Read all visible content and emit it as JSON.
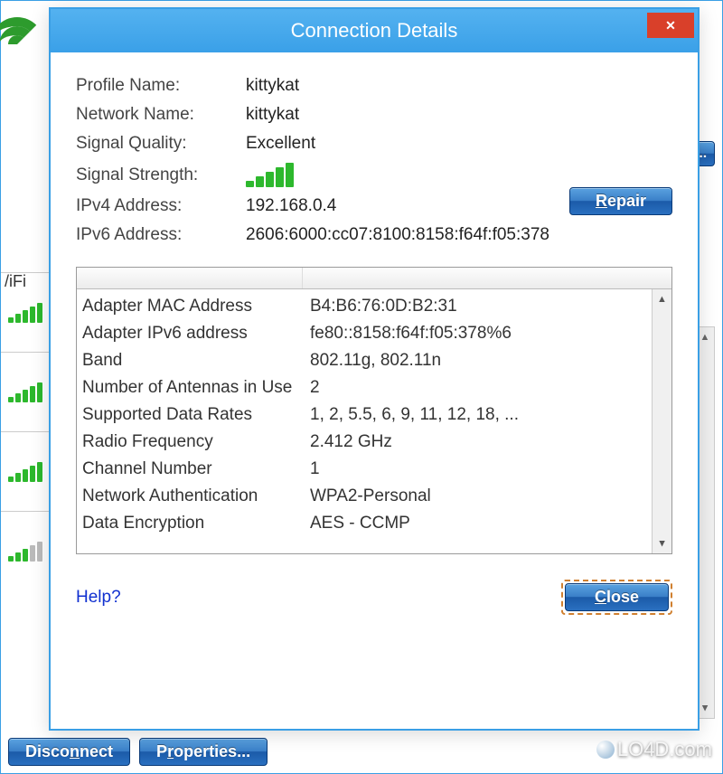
{
  "background": {
    "wifi_tab_label": "/iFi",
    "s_button_label": "s...",
    "bottom_buttons": {
      "disconnect": "Disconnect",
      "disconnect_ul": "n",
      "properties": "Properties...",
      "properties_ul": "r"
    }
  },
  "modal": {
    "title": "Connection Details",
    "summary": {
      "profile_name_label": "Profile Name:",
      "profile_name_value": "kittykat",
      "network_name_label": "Network Name:",
      "network_name_value": "kittykat",
      "signal_quality_label": "Signal Quality:",
      "signal_quality_value": "Excellent",
      "signal_strength_label": "Signal Strength:",
      "ipv4_label": "IPv4 Address:",
      "ipv4_value": "192.168.0.4",
      "ipv6_label": "IPv6 Address:",
      "ipv6_value": "2606:6000:cc07:8100:8158:f64f:f05:378"
    },
    "repair_button": "Repair",
    "repair_ul": "R",
    "details": [
      {
        "k": "Adapter MAC Address",
        "v": "B4:B6:76:0D:B2:31"
      },
      {
        "k": "Adapter IPv6 address",
        "v": "fe80::8158:f64f:f05:378%6"
      },
      {
        "k": "Band",
        "v": "802.11g, 802.11n"
      },
      {
        "k": "Number of Antennas in Use",
        "v": "2"
      },
      {
        "k": "Supported Data Rates",
        "v": "1, 2, 5.5, 6, 9, 11, 12, 18, ..."
      },
      {
        "k": "Radio Frequency",
        "v": "2.412 GHz"
      },
      {
        "k": "Channel Number",
        "v": "1"
      },
      {
        "k": "Network Authentication",
        "v": "WPA2-Personal"
      },
      {
        "k": "Data Encryption",
        "v": "AES - CCMP"
      }
    ],
    "help_label": "Help?",
    "close_button": "Close",
    "close_ul": "C"
  },
  "watermark": "LO4D.com"
}
